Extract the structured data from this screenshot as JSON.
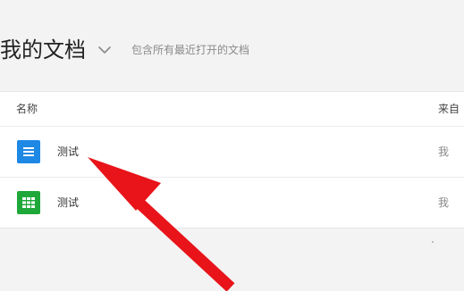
{
  "header": {
    "title": "我的文档",
    "dropdown_icon": "chevron-down-icon",
    "subtitle": "包含所有最近打开的文档"
  },
  "table": {
    "columns": {
      "name": "名称",
      "source": "来自"
    },
    "rows": [
      {
        "name": "测试",
        "source": "我",
        "icon": "document-icon",
        "icon_color": "#1e88e5"
      },
      {
        "name": "测试",
        "source": "我",
        "icon": "spreadsheet-icon",
        "icon_color": "#1fa83a"
      }
    ]
  },
  "annotation": {
    "arrow_color": "#e8141a",
    "arrow_icon": "red-arrow-icon"
  }
}
